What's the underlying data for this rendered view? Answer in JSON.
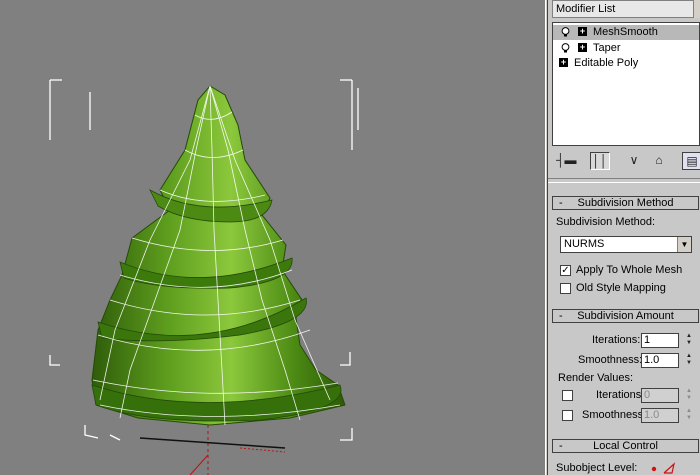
{
  "modifier_list": {
    "label": "Modifier List"
  },
  "stack": [
    {
      "label": "MeshSmooth",
      "has_bulb": true,
      "selected": true
    },
    {
      "label": "Taper",
      "has_bulb": true,
      "selected": false
    },
    {
      "label": "Editable Poly",
      "has_bulb": false,
      "selected": false
    }
  ],
  "toolbar": {
    "pin_icon": "pin-stack-icon",
    "show_end_icon": "show-end-result-icon",
    "unique_icon": "make-unique-icon",
    "remove_icon": "remove-modifier-icon",
    "configure_icon": "configure-modifier-sets-icon"
  },
  "subdivision_method": {
    "title": "Subdivision Method",
    "collapse": "-",
    "method_label": "Subdivision Method:",
    "method_value": "NURMS",
    "apply_whole_mesh": {
      "label": "Apply To Whole Mesh",
      "checked": true
    },
    "old_style_mapping": {
      "label": "Old Style Mapping",
      "checked": false
    }
  },
  "subdivision_amount": {
    "title": "Subdivision Amount",
    "collapse": "-",
    "iterations_label": "Iterations:",
    "iterations_value": "1",
    "smoothness_label": "Smoothness:",
    "smoothness_value": "1.0",
    "render_values_label": "Render Values:",
    "render_iterations": {
      "label": "Iterations:",
      "value": "0",
      "checked": false
    },
    "render_smoothness": {
      "label": "Smoothness:",
      "value": "1.0",
      "checked": false
    }
  },
  "local_control": {
    "title": "Local Control",
    "collapse": "-",
    "subobject_level_label": "Subobject Level:"
  },
  "colors": {
    "viewport_bg": "#808080",
    "mesh_green": "#5e9e1e",
    "panel_bg": "#c8c8c8",
    "selected_item": "#b8b8b8"
  }
}
